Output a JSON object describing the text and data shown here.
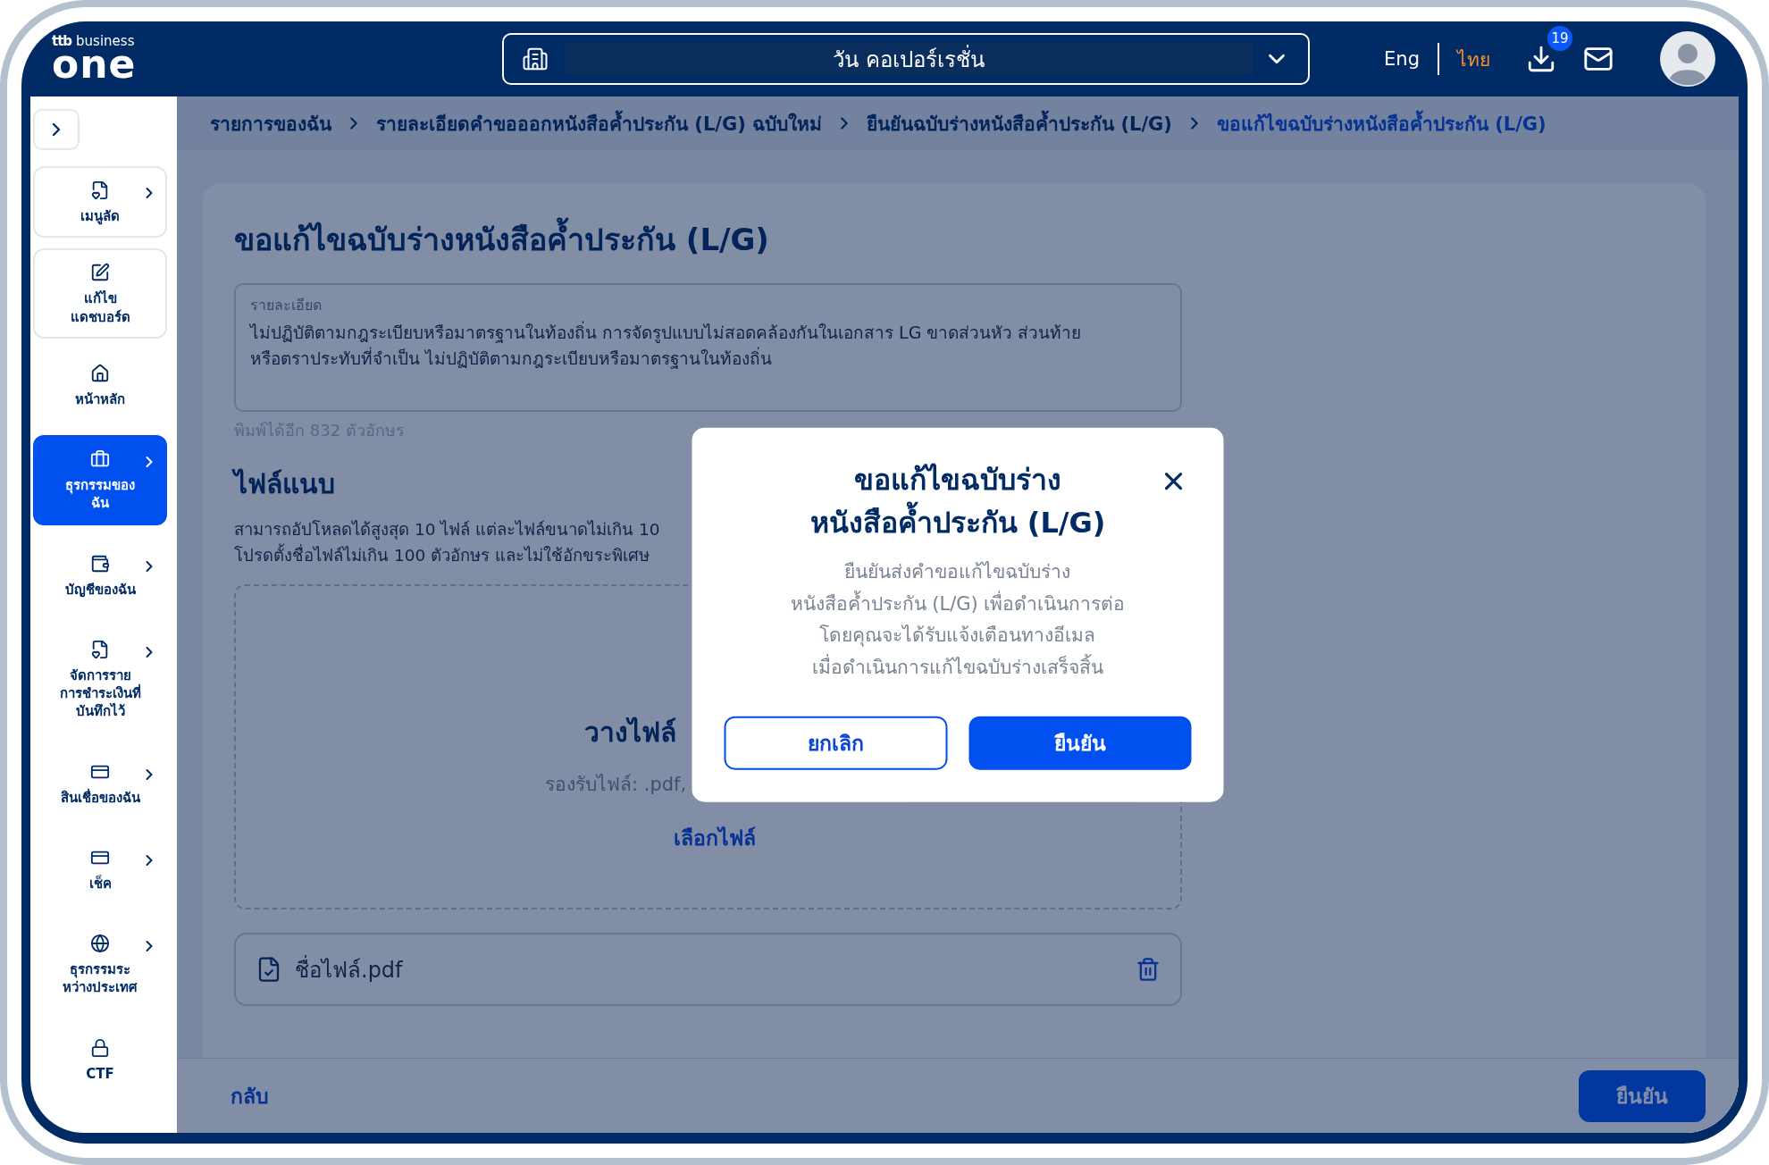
{
  "header": {
    "logo": {
      "brand": "ttb",
      "suffix": "business",
      "wordmark": "one"
    },
    "company_selector": {
      "value": "วัน คอเปอร์เรชั่น"
    },
    "languages": [
      {
        "label": "Eng",
        "selected": false
      },
      {
        "label": "ไทย",
        "selected": true
      }
    ],
    "downloads": {
      "badge": "19"
    }
  },
  "sidebar": {
    "items": [
      {
        "label": "เมนูลัด",
        "kind": "card",
        "submenu": true,
        "selected": false
      },
      {
        "label": "แก้ไข\nแดชบอร์ด",
        "kind": "card",
        "submenu": false,
        "selected": false
      },
      {
        "label": "หน้าหลัก",
        "kind": "plain",
        "submenu": false,
        "selected": false
      },
      {
        "label": "ธุรกรรมของ\nฉัน",
        "kind": "plain",
        "submenu": true,
        "selected": true
      },
      {
        "label": "บัญชีของฉัน",
        "kind": "plain",
        "submenu": true,
        "selected": false
      },
      {
        "label": "จัดการราย\nการชำระเงินที่\nบันทึกไว้",
        "kind": "plain",
        "submenu": true,
        "selected": false
      },
      {
        "label": "สินเชื่อของฉัน",
        "kind": "plain",
        "submenu": true,
        "selected": false
      },
      {
        "label": "เช็ค",
        "kind": "plain",
        "submenu": true,
        "selected": false
      },
      {
        "label": "ธุรกรรมระ\nหว่างประเทศ",
        "kind": "plain",
        "submenu": true,
        "selected": false
      },
      {
        "label": "CTF",
        "kind": "plain",
        "submenu": false,
        "selected": false
      }
    ]
  },
  "breadcrumb": [
    {
      "label": "รายการของฉัน",
      "current": false
    },
    {
      "label": "รายละเอียดคำขอออกหนังสือค้ำประกัน (L/G) ฉบับใหม่",
      "current": false
    },
    {
      "label": "ยืนยันฉบับร่างหนังสือค้ำประกัน (L/G)",
      "current": false
    },
    {
      "label": "ขอแก้ไขฉบับร่างหนังสือค้ำประกัน (L/G)",
      "current": true
    }
  ],
  "page": {
    "title": "ขอแก้ไขฉบับร่างหนังสือค้ำประกัน (L/G)",
    "details_field": {
      "label": "รายละเอียด",
      "value": "ไม่ปฏิบัติตามกฎระเบียบหรือมาตรฐานในท้องถิ่น การจัดรูปแบบไม่สอดคล้องกันในเอกสาร LG ขาดส่วนหัว ส่วนท้าย\nหรือตราประทับที่จำเป็น ไม่ปฏิบัติตามกฎระเบียบหรือมาตรฐานในท้องถิ่น"
    },
    "char_counter": "พิมพ์ได้อีก 832 ตัวอักษร",
    "attachments": {
      "title": "ไฟล์แนบ",
      "hint_lines": [
        "สามารถอัปโหลดได้สูงสุด 10 ไฟล์ แต่ละไฟล์ขนาดไม่เกิน 10",
        "โปรดตั้งชื่อไฟล์ไม่เกิน 100 ตัวอักษร และไม่ใช้อักขระพิเศษ"
      ],
      "dropzone": {
        "prompt": "วางไฟล์",
        "formats": "รองรับไฟล์: .pdf,",
        "choose_link": "เลือกไฟล์"
      },
      "files": [
        {
          "name": "ชื่อไฟล์.pdf"
        }
      ]
    }
  },
  "footer": {
    "back": "กลับ",
    "confirm": "ยืนยัน"
  },
  "dialog": {
    "title": "ขอแก้ไขฉบับร่าง\nหนังสือค้ำประกัน (L/G)",
    "message": "ยืนยันส่งคำขอแก้ไขฉบับร่าง\nหนังสือค้ำประกัน (L/G) เพื่อดำเนินการต่อ\nโดยคุณจะได้รับแจ้งเตือนทางอีเมล\nเมื่อดำเนินการแก้ไขฉบับร่างเสร็จสิ้น",
    "buttons": [
      {
        "label": "ยกเลิก",
        "kind": "secondary"
      },
      {
        "label": "ยืนยัน",
        "kind": "primary"
      }
    ]
  }
}
